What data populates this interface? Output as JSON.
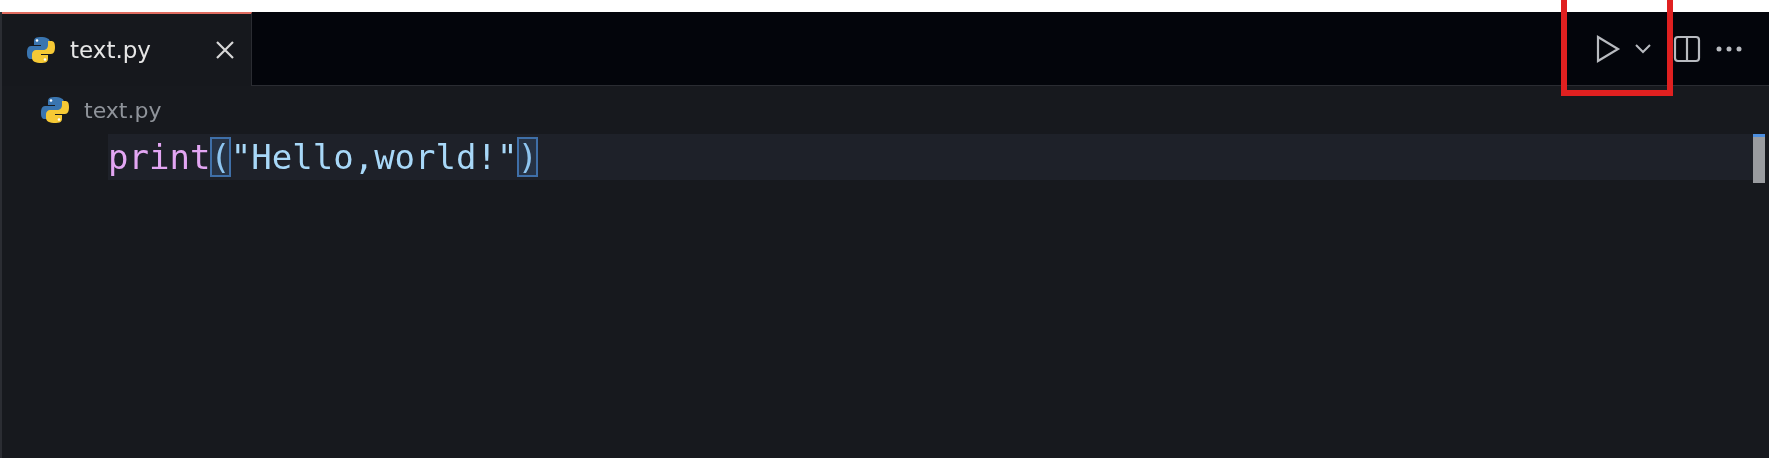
{
  "tabs": [
    {
      "label": "text.py",
      "selected": true
    }
  ],
  "toolbar": [
    {
      "kind": "run",
      "highlighted": true
    },
    {
      "kind": "dropdown",
      "highlighted": true
    },
    {
      "kind": "split",
      "highlighted": false
    },
    {
      "kind": "more",
      "highlighted": false
    }
  ],
  "breadcrumb": {
    "label": "text.py"
  },
  "code_lines": [
    {
      "tokens": [
        {
          "kind": "function",
          "text": "print",
          "matched": false
        },
        {
          "kind": "bracket",
          "text": "(",
          "matched": true
        },
        {
          "kind": "string",
          "text": "\"Hello,world!\"",
          "matched": false
        },
        {
          "kind": "bracket",
          "text": ")",
          "matched": true
        }
      ]
    }
  ]
}
